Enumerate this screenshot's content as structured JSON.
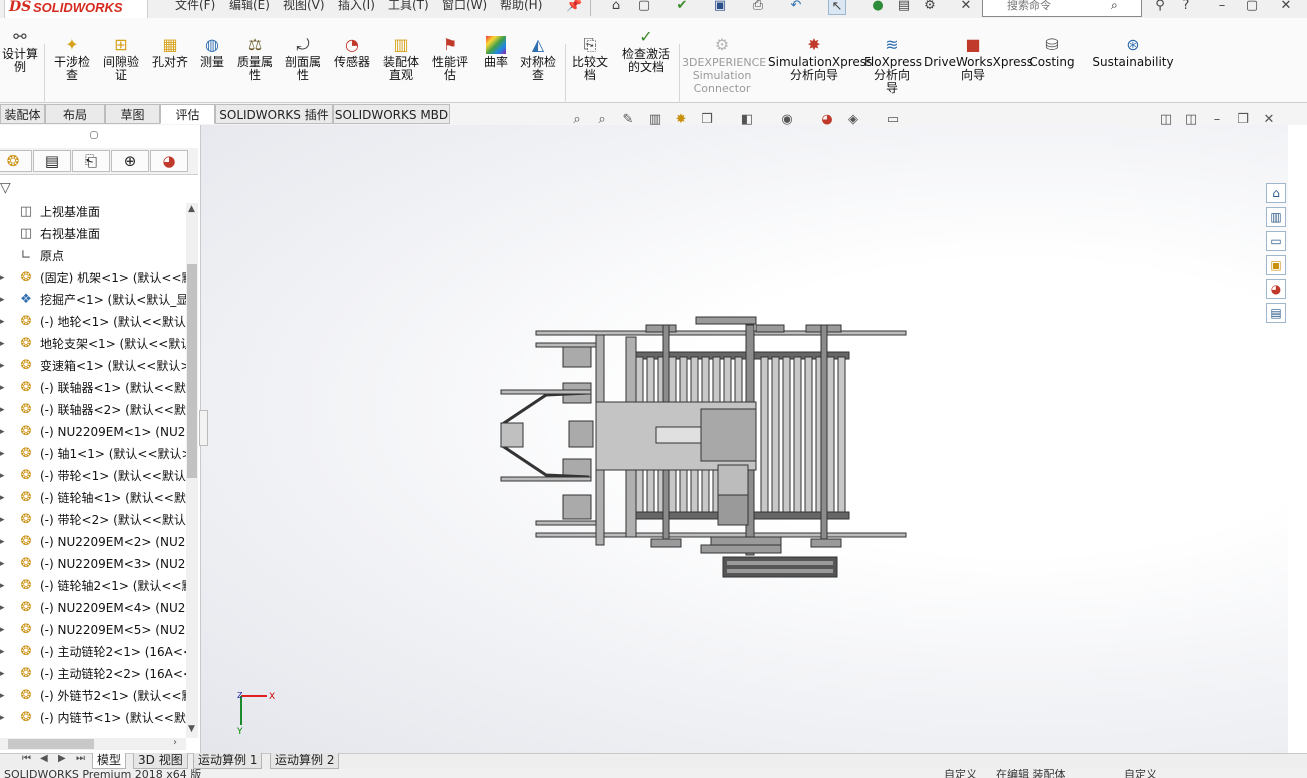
{
  "app": {
    "brand_ds": "DS",
    "brand_name": "SOLIDWORKS"
  },
  "menu": {
    "file": "文件(F)",
    "edit": "编辑(E)",
    "view": "视图(V)",
    "insert": "插入(I)",
    "tools": "工具(T)",
    "window": "窗口(W)",
    "help": "帮助(H)"
  },
  "search": {
    "placeholder": "搜索命令"
  },
  "ribbon": {
    "design_study": "设计算\n例",
    "interference": "干涉检\n查",
    "clearance": "间隙验\n证",
    "hole_align": "孔对齐",
    "measure": "测量",
    "mass_props": "质量属\n性",
    "section_props": "剖面属\n性",
    "sensor": "传感器",
    "assembly_vis": "装配体\n直观",
    "perf_eval": "性能评\n估",
    "curvature": "曲率",
    "symmetry": "对称检\n查",
    "compare_docs": "比较文\n档",
    "check_active": "检查激活\n的文档",
    "simconnector": "3DEXPERIENCE\nSimulation\nConnector",
    "simxpress": "SimulationXpress\n分析向导",
    "floxpress": "FloXpress\n分析向\n导",
    "driveworks": "DriveWorksXpress\n向导",
    "costing": "Costing",
    "sustainability": "Sustainability"
  },
  "command_tabs": [
    "装配体",
    "布局",
    "草图",
    "评估",
    "SOLIDWORKS 插件",
    "SOLIDWORKS MBD"
  ],
  "active_command_tab": "评估",
  "tree": [
    {
      "label": "上视基准面",
      "type": "plane",
      "expand": false
    },
    {
      "label": "右视基准面",
      "type": "plane",
      "expand": false
    },
    {
      "label": "原点",
      "type": "origin",
      "expand": false
    },
    {
      "label": "(固定) 机架<1> (默认<<默",
      "type": "part",
      "expand": true
    },
    {
      "label": "挖掘产<1> (默认<默认_显",
      "type": "assembly",
      "expand": true
    },
    {
      "label": "(-) 地轮<1> (默认<<默认>",
      "type": "part",
      "expand": true
    },
    {
      "label": "地轮支架<1> (默认<<默认",
      "type": "part",
      "expand": true
    },
    {
      "label": "变速箱<1> (默认<<默认>",
      "type": "part",
      "expand": true
    },
    {
      "label": "(-) 联轴器<1> (默认<<默认",
      "type": "part",
      "expand": true
    },
    {
      "label": "(-) 联轴器<2> (默认<<默认",
      "type": "part",
      "expand": true
    },
    {
      "label": "(-) NU2209EM<1> (NU22",
      "type": "part",
      "expand": true
    },
    {
      "label": "(-) 轴1<1> (默认<<默认>",
      "type": "part",
      "expand": true
    },
    {
      "label": "(-) 带轮<1> (默认<<默认>",
      "type": "part",
      "expand": true
    },
    {
      "label": "(-) 链轮轴<1> (默认<<默认",
      "type": "part",
      "expand": true
    },
    {
      "label": "(-) 带轮<2> (默认<<默认>",
      "type": "part",
      "expand": true
    },
    {
      "label": "(-) NU2209EM<2> (NU22",
      "type": "part",
      "expand": true
    },
    {
      "label": "(-) NU2209EM<3> (NU22",
      "type": "part",
      "expand": true
    },
    {
      "label": "(-) 链轮轴2<1> (默认<<默",
      "type": "part",
      "expand": true
    },
    {
      "label": "(-) NU2209EM<4> (NU22",
      "type": "part",
      "expand": true
    },
    {
      "label": "(-) NU2209EM<5> (NU22",
      "type": "part",
      "expand": true
    },
    {
      "label": "(-) 主动链轮2<1> (16A<<",
      "type": "part",
      "expand": true
    },
    {
      "label": "(-) 主动链轮2<2> (16A<<",
      "type": "part",
      "expand": true
    },
    {
      "label": "(-) 外链节2<1> (默认<<默",
      "type": "part",
      "expand": true
    },
    {
      "label": "(-) 内链节<1> (默认<<默认",
      "type": "part",
      "expand": true
    }
  ],
  "bottom_tabs": [
    "模型",
    "3D 视图",
    "运动算例 1",
    "运动算例 2"
  ],
  "active_bottom_tab": "模型",
  "status": {
    "left": "SOLIDWORKS Premium 2018 x64 版",
    "custom": "自定义",
    "editing": "在编辑 装配体",
    "custom2": "自定义"
  },
  "axes": {
    "x": "X",
    "y": "Y"
  }
}
